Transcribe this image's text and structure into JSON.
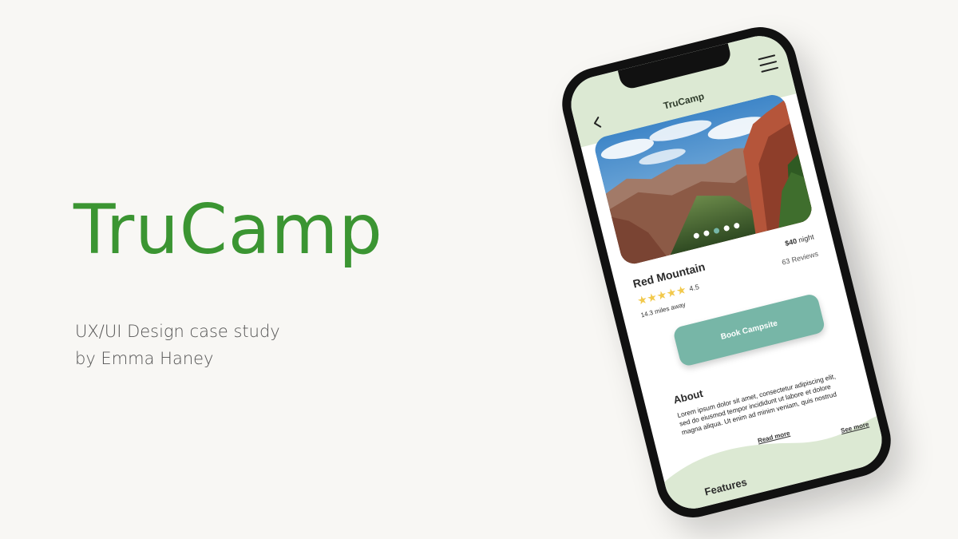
{
  "hero": {
    "brand": "TruCamp",
    "subtitle_line1": "UX/UI Design case study",
    "subtitle_line2": "by Emma Haney"
  },
  "app": {
    "title": "TruCamp",
    "back_icon": "chevron-left-icon",
    "menu_icon": "hamburger-menu-icon",
    "carousel_total": 5,
    "carousel_active": 3,
    "campsite": {
      "name": "Red Mountain",
      "price_amount": "$40",
      "price_unit": "night",
      "reviews": "63 Reviews",
      "stars": "★★★★★",
      "rating": "4.5",
      "distance": "14.3 miles away"
    },
    "book_button": "Book Campsite",
    "about": {
      "title": "About",
      "text": "Lorem ipsum dolor sit amet, consectetur adipiscing elit, sed do eiusmod tempor incididunt ut labore et dolore magna aliqua. Ut enim ad minim veniam, quis nostrud",
      "read_more": "Read more"
    },
    "features": {
      "title": "Features",
      "see_more": "See more"
    }
  },
  "colors": {
    "brand_green": "#3b9532",
    "header_green": "#dce9d3",
    "button_teal": "#77b6a7",
    "star_yellow": "#f2c94c"
  }
}
